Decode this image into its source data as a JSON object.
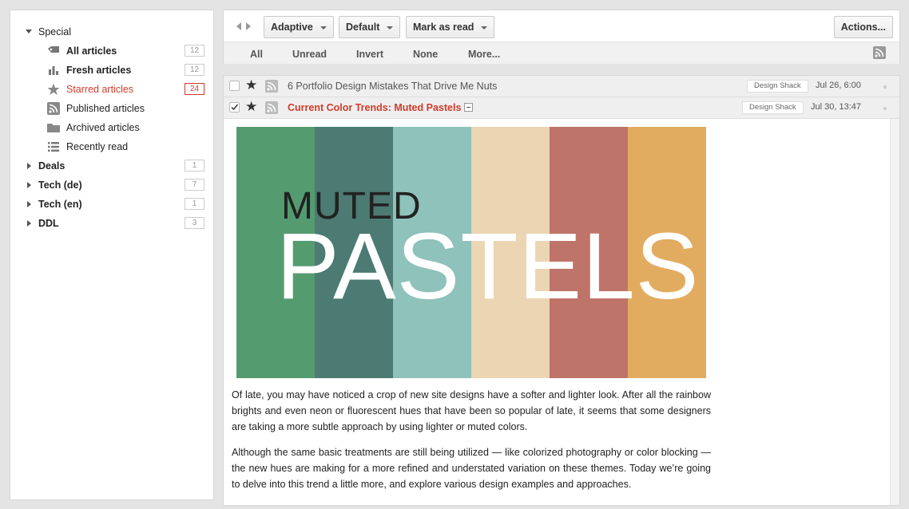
{
  "sidebar": {
    "special": {
      "label": "Special",
      "items": [
        {
          "label": "All articles",
          "count": "12"
        },
        {
          "label": "Fresh articles",
          "count": "12"
        },
        {
          "label": "Starred articles",
          "count": "24"
        },
        {
          "label": "Published articles"
        },
        {
          "label": "Archived articles"
        },
        {
          "label": "Recently read"
        }
      ]
    },
    "categories": [
      {
        "label": "Deals",
        "count": "1"
      },
      {
        "label": "Tech (de)",
        "count": "7"
      },
      {
        "label": "Tech (en)",
        "count": "1"
      },
      {
        "label": "DDL",
        "count": "3"
      }
    ]
  },
  "toolbar": {
    "view_mode": "Adaptive",
    "order": "Default",
    "mark_read": "Mark as read",
    "actions": "Actions..."
  },
  "select_bar": {
    "all": "All",
    "unread": "Unread",
    "invert": "Invert",
    "none": "None",
    "more": "More..."
  },
  "headlines": [
    {
      "title": "6 Portfolio Design Mistakes That Drive Me Nuts",
      "source": "Design Shack",
      "date": "Jul 26, 6:00"
    },
    {
      "title": "Current Color Trends: Muted Pastels",
      "source": "Design Shack",
      "date": "Jul 30, 13:47"
    }
  ],
  "article": {
    "hero_small": "MUTED",
    "hero_big": "PASTELS",
    "paragraphs": [
      "Of late, you may have noticed a crop of new site designs have a softer and lighter look. After all the rainbow brights and even neon or fluorescent hues that have been so popular of late, it seems that some designers are taking a more subtle approach by using lighter or muted colors.",
      "Although the same basic treatments are still being utilized — like colorized photography or color blocking — the new hues are making for a more refined and understated variation on these themes. Today we’re going to delve into this trend a little more, and explore various design examples and approaches."
    ]
  },
  "colors": {
    "accent_red": "#d23b2a",
    "hero_bands": [
      "#559b70",
      "#4b7b73",
      "#8ec2bb",
      "#ecd5b2",
      "#be7469",
      "#e2ac60"
    ]
  }
}
